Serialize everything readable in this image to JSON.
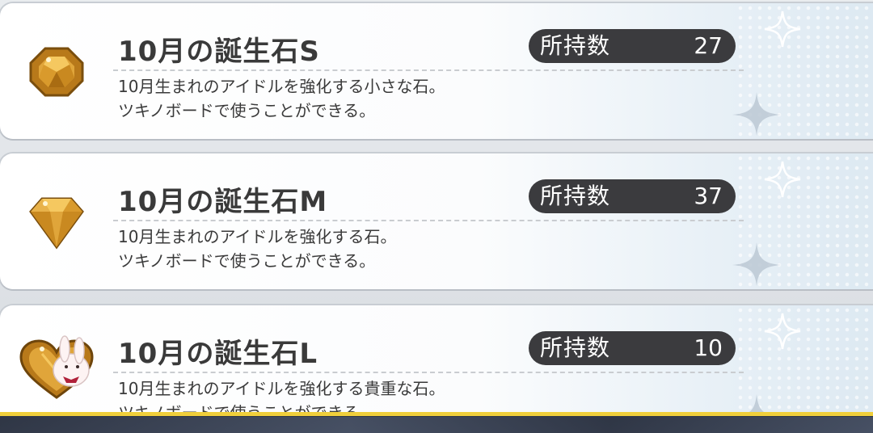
{
  "items": [
    {
      "title": "10月の誕生石S",
      "owned_label": "所持数",
      "owned_count": "27",
      "desc_line1": "10月生まれのアイドルを強化する小さな石。",
      "desc_line2": "ツキノボードで使うことができる。",
      "icon": "small-gem-icon"
    },
    {
      "title": "10月の誕生石M",
      "owned_label": "所持数",
      "owned_count": "37",
      "desc_line1": "10月生まれのアイドルを強化する石。",
      "desc_line2": "ツキノボードで使うことができる。",
      "icon": "medium-gem-icon"
    },
    {
      "title": "10月の誕生石L",
      "owned_label": "所持数",
      "owned_count": "10",
      "desc_line1": "10月生まれのアイドルを強化する貴重な石。",
      "desc_line2": "ツキノボードで使うことができる。",
      "icon": "large-gem-heart-bunny-icon"
    }
  ],
  "colors": {
    "badge_bg": "#3b3b3e",
    "gem_amber": "#c8861c",
    "accent_yellow": "#f0cf3b"
  }
}
